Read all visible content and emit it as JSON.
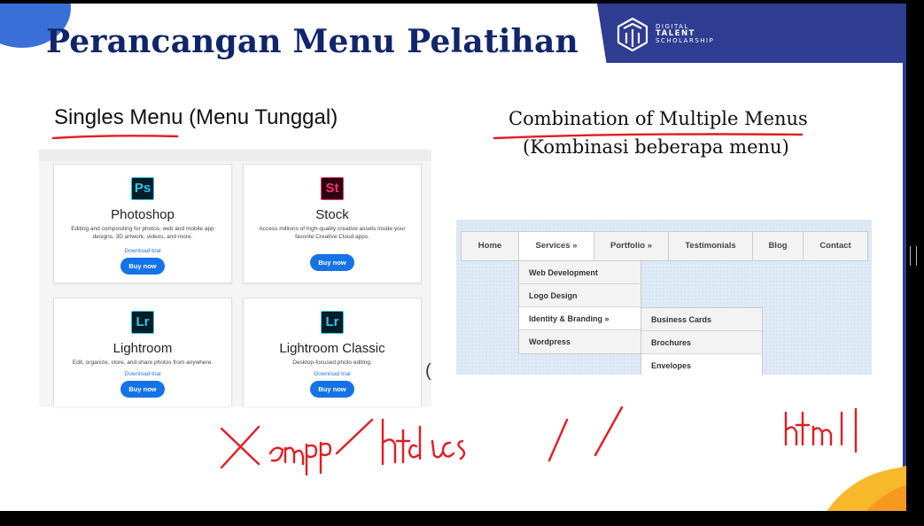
{
  "slide": {
    "title": "Perancangan Menu Pelatihan",
    "brand": {
      "line1": "DIGITAL",
      "line2": "TALENT",
      "line3": "SCHOLARSHIP"
    },
    "colors": {
      "title": "#10256b",
      "brand_bar": "#2e3c92",
      "accent_orange": "#f7b92b",
      "annotation_red": "#e31b23"
    }
  },
  "single_menu": {
    "heading": "Singles Menu (Menu Tunggal)",
    "cards": [
      {
        "icon_text": "Ps",
        "icon": "photoshop-icon",
        "icon_bg": "#001d26",
        "icon_fg": "#31c5f0",
        "name": "Photoshop",
        "desc": "Editing and compositing for photos, web and mobile app designs, 3D artwork, videos, and more.",
        "trial": "Download trial",
        "button": "Buy now"
      },
      {
        "icon_text": "St",
        "icon": "stock-icon",
        "icon_bg": "#2b0010",
        "icon_fg": "#ff2f6a",
        "name": "Stock",
        "desc": "Access millions of high-quality creative assets inside your favorite Creative Cloud apps.",
        "trial": "",
        "button": "Buy now"
      },
      {
        "icon_text": "Lr",
        "icon": "lightroom-icon",
        "icon_bg": "#001d26",
        "icon_fg": "#31c5f0",
        "name": "Lightroom",
        "desc": "Edit, organize, store, and share photos from anywhere.",
        "trial": "Download trial",
        "button": "Buy now"
      },
      {
        "icon_text": "Lr",
        "icon": "lightroom-classic-icon",
        "icon_bg": "#001d26",
        "icon_fg": "#31c5f0",
        "name": "Lightroom Classic",
        "desc": "Desktop-focused photo editing.",
        "trial": "Download trial",
        "button": "Buy now"
      }
    ]
  },
  "multi_menu": {
    "heading": "Combination of Multiple Menus",
    "subheading": "(Kombinasi beberapa menu)",
    "main_items": [
      "Home",
      "Services »",
      "Portfolio »",
      "Testimonials",
      "Blog",
      "Contact"
    ],
    "services_submenu": [
      "Web Development",
      "Logo Design",
      "Identity & Branding »",
      "Wordpress"
    ],
    "branding_submenu": [
      "Business Cards",
      "Brochures",
      "Envelopes"
    ]
  },
  "annotations": {
    "handwriting_1": "xampp/htdocs /",
    "handwriting_2": "html"
  }
}
